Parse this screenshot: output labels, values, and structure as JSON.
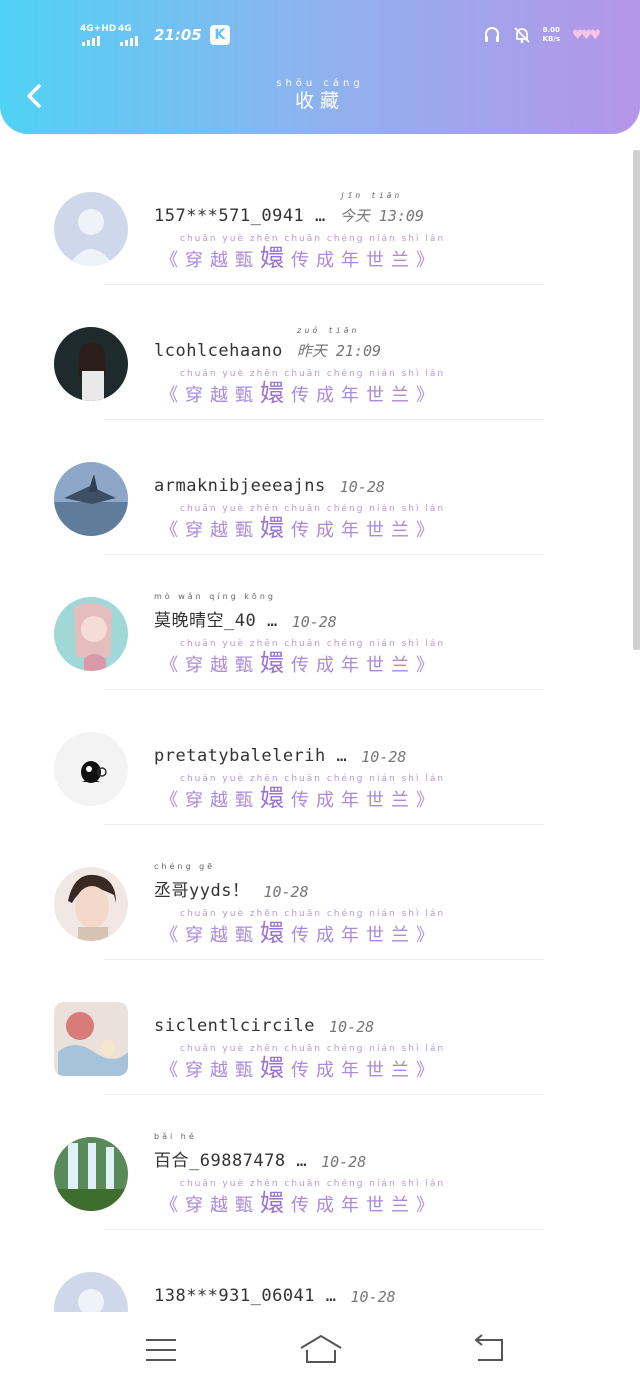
{
  "status_bar": {
    "network1": "4G+HD",
    "network2": "4G",
    "time": "21:05",
    "app_badge": "K",
    "net_speed_value": "8.00",
    "net_speed_unit": "KB/s"
  },
  "header": {
    "title": "收藏",
    "title_pinyin": "shōu cáng"
  },
  "message_text": {
    "pinyin": "chuān  yuè  zhēn  chuān chéng  nián   shì    lán",
    "open": "《",
    "part1": "穿越甄",
    "big": "嬛",
    "part2": "传成年世兰",
    "close": "》"
  },
  "items": [
    {
      "name": "157***571_0941 …",
      "date_pinyin": "jīn  tiān",
      "date": "今天 13:09",
      "avatar": "default-avatar"
    },
    {
      "name": "lcohlcehaano",
      "date_pinyin": "zuó  tiān",
      "date": "昨天 21:09",
      "avatar": "girl-photo"
    },
    {
      "name": "armaknibjeeeajns",
      "date_pinyin": "",
      "date": "10-28",
      "avatar": "crane-photo"
    },
    {
      "name": "莫晚晴空_40 …",
      "name_pinyin": "mò  wǎn  qíng  kōng",
      "date_pinyin": "",
      "date": "10-28",
      "avatar": "pink-girl-photo"
    },
    {
      "name": "pretatybalelerih …",
      "date_pinyin": "",
      "date": "10-28",
      "avatar": "penguin-icon"
    },
    {
      "name": "丞哥yyds！",
      "name_pinyin": "chéng  gē",
      "date_pinyin": "",
      "date": "10-28",
      "avatar": "anime-boy-photo"
    },
    {
      "name": "siclentlcircile",
      "date_pinyin": "",
      "date": "10-28",
      "avatar": "illustration-photo"
    },
    {
      "name": "百合_69887478 …",
      "name_pinyin": "bǎi   hé",
      "date_pinyin": "",
      "date": "10-28",
      "avatar": "waterfall-photo"
    },
    {
      "name": "138***931_06041 …",
      "date_pinyin": "",
      "date": "10-28",
      "avatar": "default-avatar"
    }
  ],
  "colors": {
    "header_gradient_start": "#4fd2f5",
    "header_gradient_end": "#b595e8",
    "message_purple": "#a98bd9"
  },
  "navbar": {
    "menu_icon": "menu-icon",
    "home_icon": "home-icon",
    "back_icon": "back-icon"
  }
}
